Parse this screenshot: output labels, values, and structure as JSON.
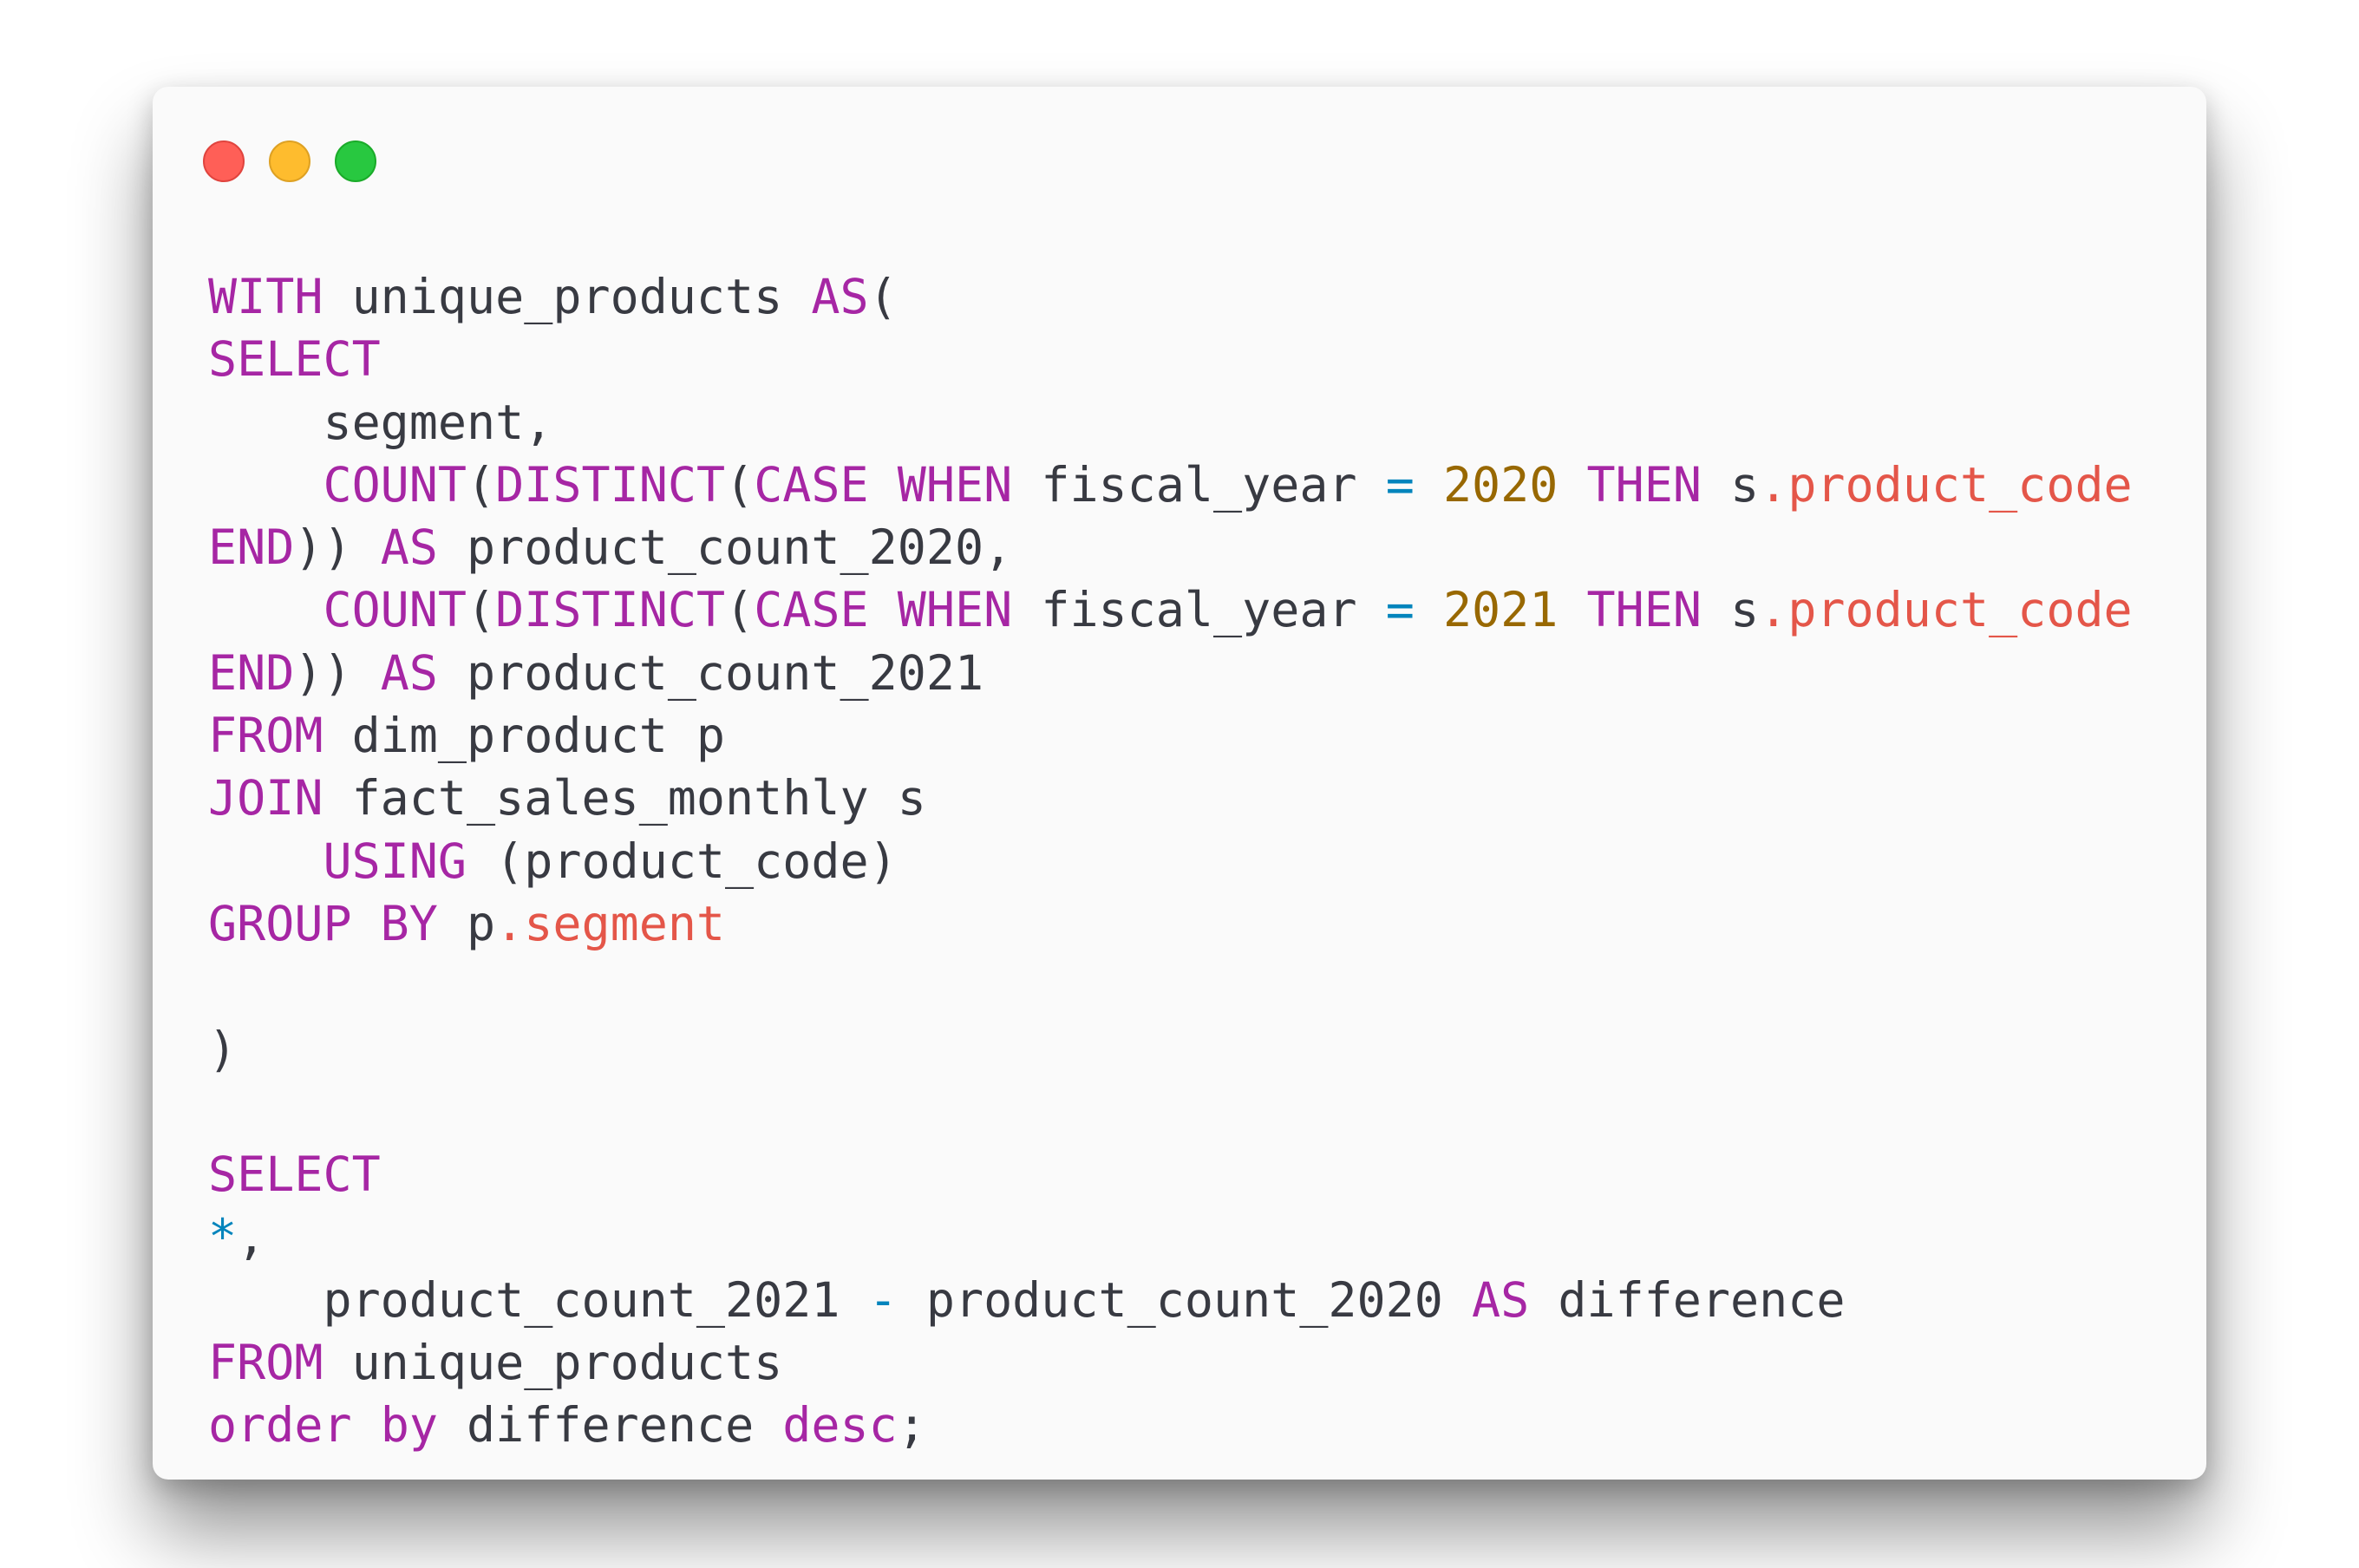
{
  "window": {
    "buttons": [
      "close",
      "minimize",
      "zoom"
    ],
    "colors": {
      "background": "#fafafa",
      "close": "#ff5f57",
      "minimize": "#febc2e",
      "zoom": "#28c840",
      "keyword": "#a626a4",
      "number": "#986801",
      "operator": "#0184bc",
      "property": "#e45649",
      "text": "#383a42"
    }
  },
  "code": {
    "language": "sql",
    "lines": [
      [
        [
          "kw",
          "WITH"
        ],
        [
          "plain",
          " unique_products "
        ],
        [
          "kw",
          "AS"
        ],
        [
          "plain",
          "("
        ]
      ],
      [
        [
          "kw",
          "SELECT"
        ]
      ],
      [
        [
          "plain",
          "    segment,"
        ]
      ],
      [
        [
          "plain",
          "    "
        ],
        [
          "kw",
          "COUNT"
        ],
        [
          "plain",
          "("
        ],
        [
          "kw",
          "DISTINCT"
        ],
        [
          "plain",
          "("
        ],
        [
          "kw",
          "CASE"
        ],
        [
          "plain",
          " "
        ],
        [
          "kw",
          "WHEN"
        ],
        [
          "plain",
          " fiscal_year "
        ],
        [
          "op",
          "="
        ],
        [
          "plain",
          " "
        ],
        [
          "num",
          "2020"
        ],
        [
          "plain",
          " "
        ],
        [
          "kw",
          "THEN"
        ],
        [
          "plain",
          " s"
        ],
        [
          "prop",
          ".product_code"
        ]
      ],
      [
        [
          "kw",
          "END"
        ],
        [
          "plain",
          ")) "
        ],
        [
          "kw",
          "AS"
        ],
        [
          "plain",
          " product_count_2020,"
        ]
      ],
      [
        [
          "plain",
          "    "
        ],
        [
          "kw",
          "COUNT"
        ],
        [
          "plain",
          "("
        ],
        [
          "kw",
          "DISTINCT"
        ],
        [
          "plain",
          "("
        ],
        [
          "kw",
          "CASE"
        ],
        [
          "plain",
          " "
        ],
        [
          "kw",
          "WHEN"
        ],
        [
          "plain",
          " fiscal_year "
        ],
        [
          "op",
          "="
        ],
        [
          "plain",
          " "
        ],
        [
          "num",
          "2021"
        ],
        [
          "plain",
          " "
        ],
        [
          "kw",
          "THEN"
        ],
        [
          "plain",
          " s"
        ],
        [
          "prop",
          ".product_code"
        ]
      ],
      [
        [
          "kw",
          "END"
        ],
        [
          "plain",
          ")) "
        ],
        [
          "kw",
          "AS"
        ],
        [
          "plain",
          " product_count_2021"
        ]
      ],
      [
        [
          "kw",
          "FROM"
        ],
        [
          "plain",
          " dim_product p"
        ]
      ],
      [
        [
          "kw",
          "JOIN"
        ],
        [
          "plain",
          " fact_sales_monthly s"
        ]
      ],
      [
        [
          "plain",
          "    "
        ],
        [
          "kw",
          "USING"
        ],
        [
          "plain",
          " (product_code)"
        ]
      ],
      [
        [
          "kw",
          "GROUP BY"
        ],
        [
          "plain",
          " p"
        ],
        [
          "prop",
          ".segment"
        ]
      ],
      [],
      [
        [
          "plain",
          ")"
        ]
      ],
      [],
      [
        [
          "kw",
          "SELECT"
        ]
      ],
      [
        [
          "op",
          "*"
        ],
        [
          "plain",
          ","
        ]
      ],
      [
        [
          "plain",
          "    product_count_2021 "
        ],
        [
          "op",
          "-"
        ],
        [
          "plain",
          " product_count_2020 "
        ],
        [
          "kw",
          "AS"
        ],
        [
          "plain",
          " difference"
        ]
      ],
      [
        [
          "kw",
          "FROM"
        ],
        [
          "plain",
          " unique_products"
        ]
      ],
      [
        [
          "kw",
          "order"
        ],
        [
          "plain",
          " "
        ],
        [
          "kw",
          "by"
        ],
        [
          "plain",
          " difference "
        ],
        [
          "kw",
          "desc"
        ],
        [
          "plain",
          ";"
        ]
      ]
    ]
  }
}
